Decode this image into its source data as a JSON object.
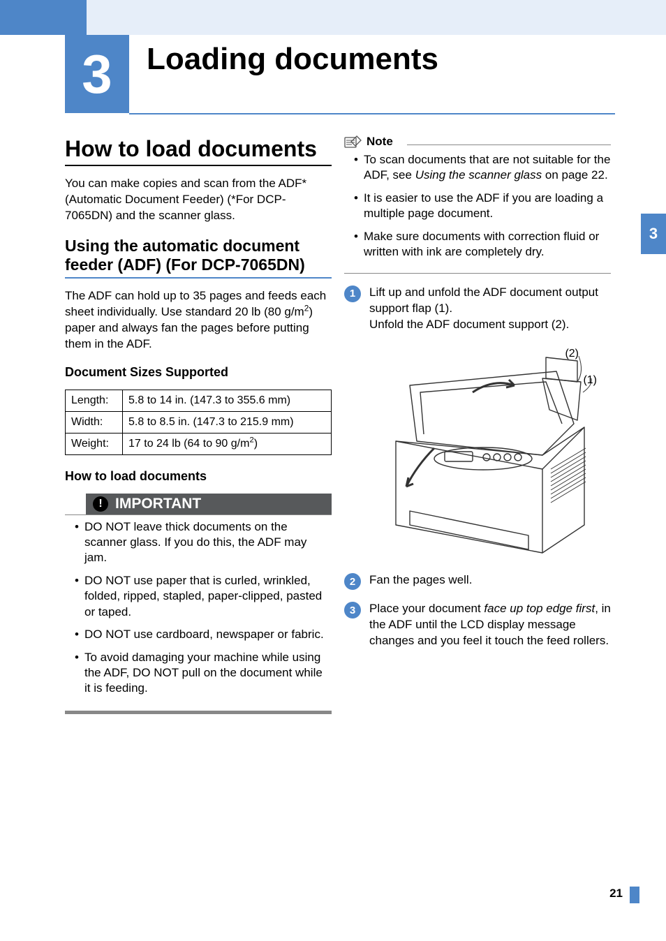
{
  "chapter": {
    "number": "3",
    "title": "Loading documents"
  },
  "side_tab": "3",
  "left": {
    "h1": "How to load documents",
    "intro": "You can make copies and scan from the ADF* (Automatic Document Feeder) (*For DCP-7065DN) and the scanner glass.",
    "h2": "Using the automatic document feeder (ADF) (For DCP-7065DN)",
    "adf_para_a": "The ADF can hold up to 35 pages and feeds each sheet individually. Use standard 20 lb (80 g/m",
    "adf_para_b": ") paper and always fan the pages before putting them in the ADF.",
    "sup2": "2",
    "h3_sizes": "Document Sizes Supported",
    "table": {
      "rows": [
        {
          "label": "Length:",
          "value": "5.8 to 14 in. (147.3 to 355.6 mm)"
        },
        {
          "label": "Width:",
          "value": "5.8 to 8.5 in. (147.3 to 215.9 mm)"
        },
        {
          "label": "Weight:",
          "value_a": "17 to 24 lb (64 to 90 g/m",
          "value_b": ")"
        }
      ]
    },
    "h3_howto": "How to load documents",
    "important": {
      "title": "IMPORTANT",
      "items": [
        "DO NOT leave thick documents on the scanner glass. If you do this, the ADF may jam.",
        "DO NOT use paper that is curled, wrinkled, folded, ripped, stapled, paper-clipped, pasted or taped.",
        "DO NOT use cardboard, newspaper or fabric.",
        "To avoid damaging your machine while using the ADF, DO NOT pull on the document while it is feeding."
      ]
    }
  },
  "right": {
    "note": {
      "label": "Note",
      "items_a": "To scan documents that are not suitable for the ADF, see ",
      "items_a_italic": "Using the scanner glass",
      "items_a_tail": " on page 22.",
      "item_b": "It is easier to use the ADF if you are loading a multiple page document.",
      "item_c": "Make sure documents with correction fluid or written with ink are completely dry."
    },
    "steps": {
      "s1_num": "1",
      "s1_a": "Lift up and unfold the ADF document output support flap (1).",
      "s1_b": "Unfold the ADF document support (2).",
      "fig_label_1": "(1)",
      "fig_label_2": "(2)",
      "s2_num": "2",
      "s2": "Fan the pages well.",
      "s3_num": "3",
      "s3_a": "Place your document ",
      "s3_italic": "face up top edge first",
      "s3_b": ", in the ADF until the LCD display message changes and you feel it touch the feed rollers."
    }
  },
  "page_number": "21"
}
